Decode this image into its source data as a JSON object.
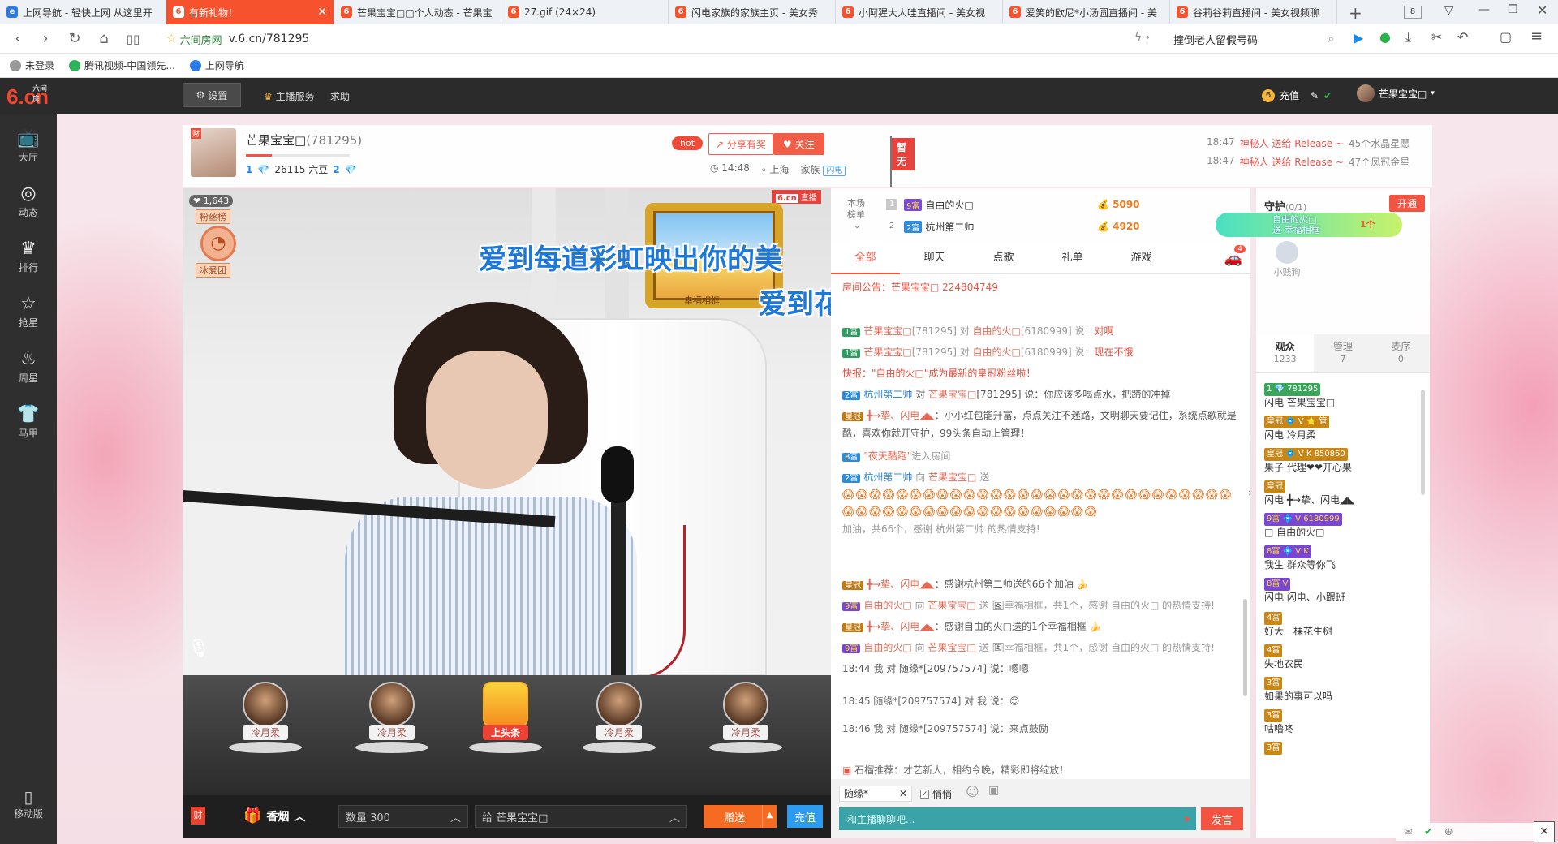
{
  "browser": {
    "tabs": [
      {
        "title": "上网导航 - 轻快上网 从这里开",
        "color": "#2c7be5",
        "glyph": "e"
      },
      {
        "title": "有新礼物！",
        "color": "#f6522e",
        "glyph": "6",
        "active": true
      },
      {
        "title": "芒果宝宝□□个人动态 - 芒果宝",
        "color": "#f6522e",
        "glyph": "6"
      },
      {
        "title": "27.gif (24×24)",
        "color": "#f6522e",
        "glyph": "6"
      },
      {
        "title": "闪电家族的家族主页 - 美女秀",
        "color": "#f6522e",
        "glyph": "6"
      },
      {
        "title": "小阿猩大人哇直播间 - 美女视",
        "color": "#f6522e",
        "glyph": "6"
      },
      {
        "title": "爱笑的欧尼*小汤圆直播间 - 美",
        "color": "#f6522e",
        "glyph": "6"
      },
      {
        "title": "谷莉谷莉直播间 - 美女视频聊",
        "color": "#f6522e",
        "glyph": "6"
      }
    ],
    "tab_count": "8",
    "url_site": "六间房网",
    "url": "v.6.cn/781295",
    "search_text": "撞倒老人留假号码",
    "bookmarks": [
      "未登录",
      "腾讯视频-中国领先...",
      "上网导航"
    ]
  },
  "header": {
    "logo_small": "六间房",
    "logo_main": "6.cn",
    "settings": "设置",
    "host_service": "主播服务",
    "help": "求助",
    "recharge": "充值",
    "username": "芒果宝宝□"
  },
  "leftnav": [
    "大厅",
    "动态",
    "排行",
    "抢星",
    "周星",
    "马甲"
  ],
  "mobile": "移动版",
  "host": {
    "name": "芒果宝宝□",
    "room_id": "(781295)",
    "level_a": "1",
    "beans": "26115 六豆",
    "level_b": "2",
    "progress": 0.25,
    "hot": "hot",
    "share": "分享有奖",
    "follow": "关注",
    "time": "14:48",
    "city": "上海",
    "family": "家族",
    "family_badge": "闪电",
    "flag": "暂无"
  },
  "gift_feed": [
    {
      "time": "18:47",
      "who": "神秘人 送给 Release ~",
      "what": "45个水晶星愿"
    },
    {
      "time": "18:47",
      "who": "神秘人 送给 Release ~",
      "what": "47个凤冠金星"
    }
  ],
  "video": {
    "live_num": "6.cn",
    "live_label": "直播",
    "fan_count": "1,643",
    "fan_top": "粉丝榜",
    "fan_bottom": "冰爱团",
    "frame_label": "幸福相框",
    "lyric_1": "爱到每道彩虹映出你的美",
    "lyric_2": "爱到花儿绽放鸟儿成群把我们环绕"
  },
  "seats": [
    "冷月柔",
    "冷月柔",
    "上头条",
    "冷月柔",
    "冷月柔"
  ],
  "giftbar": {
    "gift_icon": "财",
    "gift_name": "香烟",
    "quantity": "数量  300",
    "to": "给  芒果宝宝□",
    "give": "赠送",
    "charge": "充值"
  },
  "rank": {
    "title": "本场榜单",
    "rows": [
      {
        "no": "1",
        "lv": "9富",
        "name": "自由的火□",
        "pts": "5090"
      },
      {
        "no": "2",
        "lv": "2富",
        "name": "杭州第二帅",
        "pts": "4920"
      }
    ]
  },
  "chat_tabs": [
    "全部",
    "聊天",
    "点歌",
    "礼单",
    "游戏"
  ],
  "car_badge": "4",
  "chat": {
    "pinned": "房间公告：芒果宝宝□ 224804749",
    "messages": [
      {
        "lv": "1富",
        "u": "芒果宝宝□",
        "rest": "[781295] 对 ",
        "b": "自由的火□",
        "rest2": "[6180999] 说：",
        "r": "对啊"
      },
      {
        "lv": "1富",
        "u": "芒果宝宝□",
        "rest": "[781295] 对 ",
        "b": "自由的火□",
        "rest2": "[6180999] 说：",
        "r": "现在不饿"
      },
      {
        "r_full": "快报：\"自由的火□\"成为最新的皇冠粉丝啦！"
      },
      {
        "lv": "2富",
        "u": "杭州第二帅",
        "rest": " 对 ",
        "b": "芒果宝宝□",
        "rest2": "[781295] 说：你应该多喝点水，把蹄的冲掉"
      },
      {
        "lv": "皇冠",
        "u": "╋→挚、闪电◢◣",
        "rest": "：小小红包能升富，点点关注不迷路，文明聊天要记住，系统点歌就是酷，喜欢你就开守护，99头条自动上管理！"
      },
      {
        "lv": "8富",
        "u": "\"夜天酷跑\"",
        "rest": "进入房间"
      },
      {
        "lv": "2富",
        "u": "杭州第二帅",
        "rest": " 向 ",
        "b": "芒果宝宝□",
        "rest2": " 送",
        "gifts": "😱😱😱😱😱😱😱😱😱😱😱😱😱😱😱😱😱😱😱😱😱😱😱😱😱😱😱😱😱😱😱😱😱😱😱😱😱😱😱😱😱😱😱😱😱😱😱😱",
        "tail": "加油，共66个，感谢 杭州第二帅 的热情支持!"
      },
      {
        "lv": "皇冠",
        "u": "╋→挚、闪电◢◣",
        "rest": "：感谢杭州第二帅送的66个加油"
      },
      {
        "lv": "9富",
        "u": "自由的火□",
        "rest": " 向 ",
        "b": "芒果宝宝□",
        "rest2": " 送 ",
        "tail": "幸福相框，共1个，感谢 自由的火□ 的热情支持!"
      },
      {
        "lv": "皇冠",
        "u": "╋→挚、闪电◢◣",
        "rest": "：感谢自由的火□送的1个幸福相框"
      },
      {
        "lv": "9富",
        "u": "自由的火□",
        "rest": " 向 ",
        "b": "芒果宝宝□",
        "rest2": " 送 ",
        "tail": "幸福相框，共1个，感谢 自由的火□ 的热情支持!"
      },
      {
        "g": "18:44  我 对 随缘*[209757574] 说：嗯嗯"
      },
      {
        "g": "18:45  随缘*[209757574] 对 我 说：😊"
      },
      {
        "g": "18:46  我 对 随缘*[209757574] 说：来点鼓励"
      }
    ],
    "notice": "石榴推荐：才艺新人，相约今晚，精彩即将绽放！",
    "target": "随缘*",
    "whisper": "悄悄",
    "placeholder": "和主播聊聊吧...",
    "send": "发言"
  },
  "guard": {
    "title": "守护",
    "count": "(0/1)",
    "open": "开通",
    "banner_1": "自由的火□",
    "banner_2": "送 幸福相框",
    "banner_count": "1个",
    "slot": "小贱狗"
  },
  "audience_tabs": [
    {
      "label": "观众",
      "n": "1233"
    },
    {
      "label": "管理",
      "n": "7"
    },
    {
      "label": "麦序",
      "n": "0"
    }
  ],
  "audience": [
    {
      "l1": "1 💎 781295",
      "l2": "闪电  芒果宝宝□"
    },
    {
      "l1": "皇冠 💠 V ⭐ 管",
      "l2": "闪电  冷月柔"
    },
    {
      "l1": "皇冠 💠 V K 850860",
      "l2": "果子  代理❤❤开心果"
    },
    {
      "l1": "皇冠",
      "l2": "闪电  ╋→挚、闪电◢◣"
    },
    {
      "l1": "9富 💠 V 6180999",
      "l2": "□ 自由的火□"
    },
    {
      "l1": "8富 💠 V K",
      "l2": "我生  群众等你飞"
    },
    {
      "l1": "8富 V",
      "l2": "闪电  闪电、小跟班"
    },
    {
      "l1": "4富",
      "l2": "好大一棵花生树"
    },
    {
      "l1": "4富",
      "l2": "失地农民"
    },
    {
      "l1": "3富",
      "l2": "如果的事可以吗"
    },
    {
      "l1": "3富",
      "l2": "咕噜咚"
    },
    {
      "l1": "3富",
      "l2": ""
    }
  ]
}
